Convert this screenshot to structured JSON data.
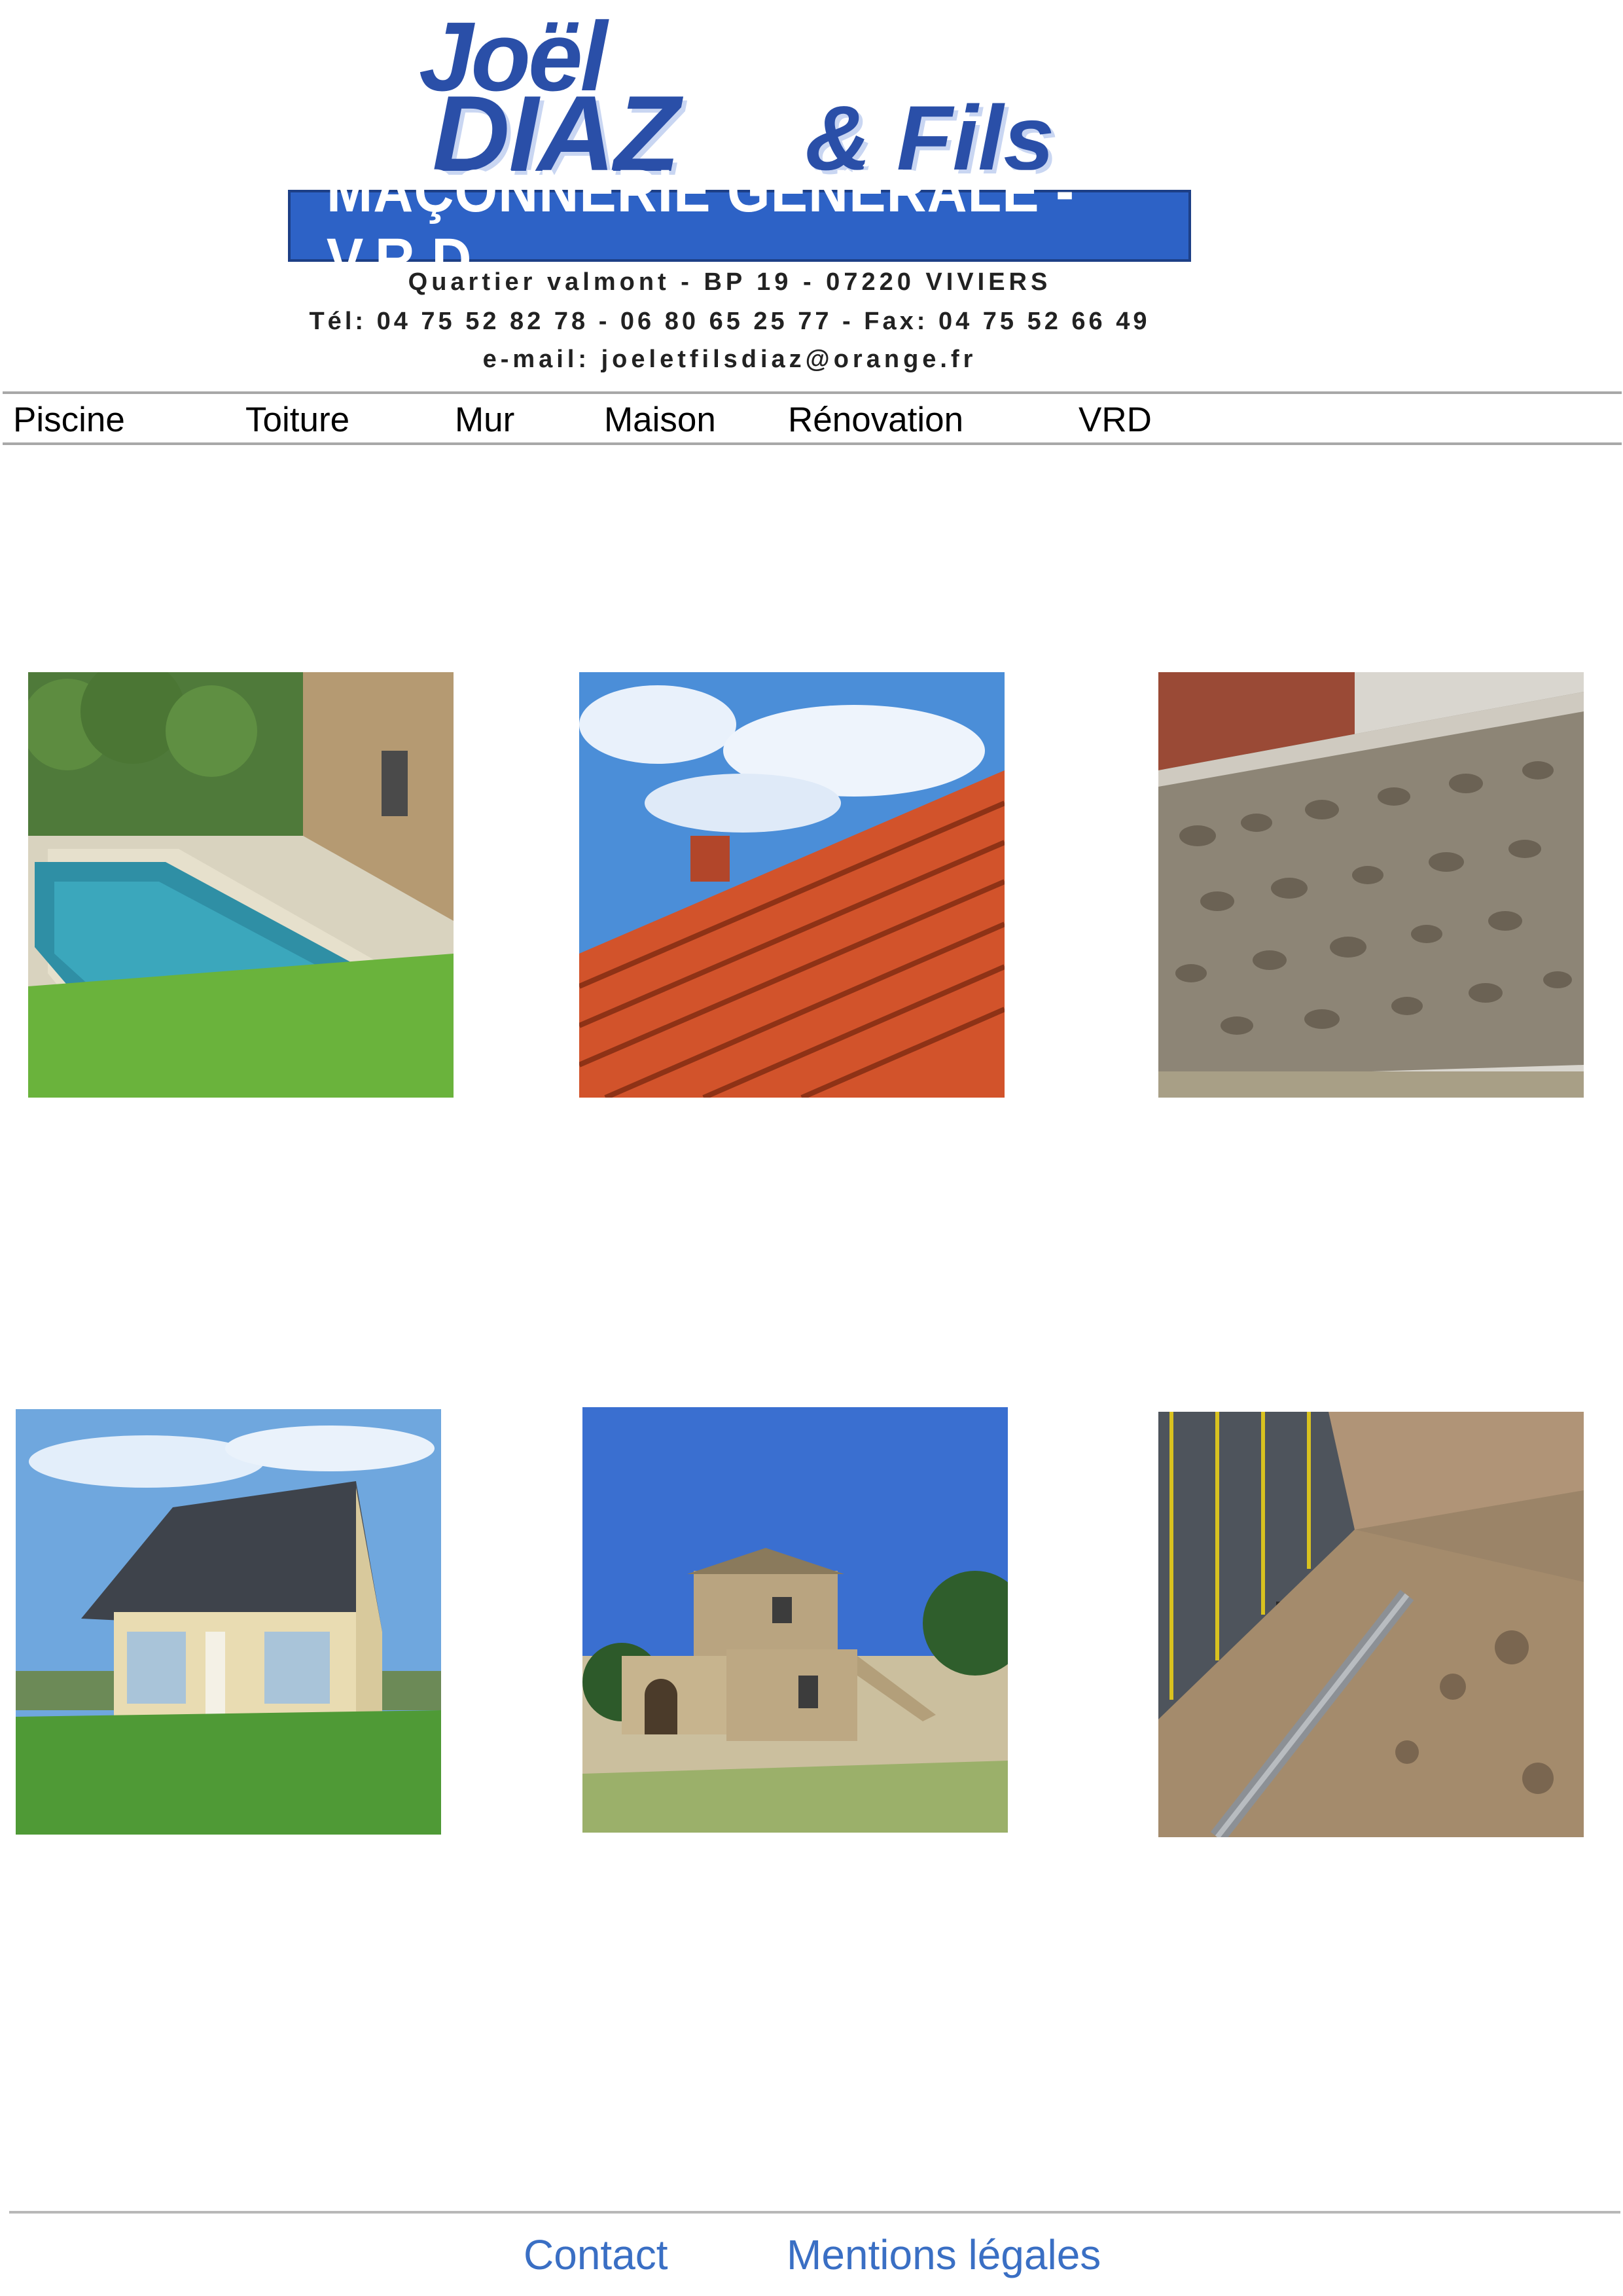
{
  "header": {
    "logo": {
      "name_script": "Joël",
      "name_main": "DIAZ",
      "name_suffix": "& Fils",
      "banner": "MAÇONNERIE GÉNÉRALE - V.R.D",
      "address": "Quartier valmont - BP 19 - 07220 VIVIERS",
      "phone": "Tél: 04 75 52 82 78 - 06 80 65 25 77 - Fax: 04 75 52 66 49",
      "email": "e-mail: joeletfilsdiaz@orange.fr"
    }
  },
  "nav": {
    "items": [
      {
        "label": "Piscine"
      },
      {
        "label": "Toiture"
      },
      {
        "label": "Mur"
      },
      {
        "label": "Maison"
      },
      {
        "label": "Rénovation"
      },
      {
        "label": "VRD"
      }
    ]
  },
  "gallery": {
    "tiles": [
      {
        "subject": "pool"
      },
      {
        "subject": "roof-tiles"
      },
      {
        "subject": "stone-wall"
      },
      {
        "subject": "house"
      },
      {
        "subject": "stone-house"
      },
      {
        "subject": "trench-pipes"
      }
    ]
  },
  "footer": {
    "contact": "Contact",
    "legal": "Mentions légales"
  },
  "colors": {
    "brand_blue": "#2d62c6",
    "link_blue": "#3a6fc4",
    "rule_gray": "#a8a8a8"
  }
}
